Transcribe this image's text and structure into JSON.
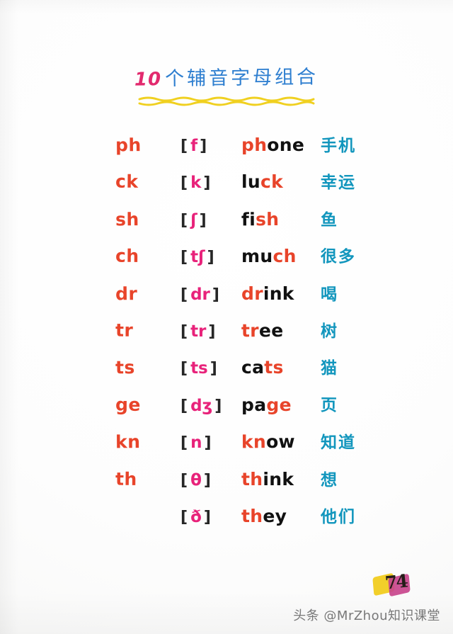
{
  "page": {
    "title": "10个辅音字母组合",
    "title_number": "10",
    "title_text": "个辅音字母组合",
    "colors": {
      "combo_orange": "#e8442a",
      "phonetic_pink": "#e8227a",
      "chinese_teal": "#1296bd",
      "title_blue": "#2f7fd0",
      "title_red": "#e22a6e",
      "underline_yellow": "#f0d020",
      "word_black": "#111111",
      "paper_white": "#fefefe"
    }
  },
  "rows": [
    {
      "combo": "ph",
      "bracket_open": "[",
      "phonetic": "f",
      "bracket_close": "]",
      "word_head": "ph",
      "word_tail": "one",
      "word_head_highlighted": true,
      "word": "phone",
      "chinese": "手机"
    },
    {
      "combo": "ck",
      "bracket_open": "[",
      "phonetic": "k",
      "bracket_close": "]",
      "word_head": "lu",
      "word_tail": "ck",
      "word_head_highlighted": false,
      "word": "luck",
      "chinese": "幸运"
    },
    {
      "combo": "sh",
      "bracket_open": "[",
      "phonetic": "ʃ",
      "bracket_close": "]",
      "word_head": "fi",
      "word_tail": "sh",
      "word_head_highlighted": false,
      "word": "fish",
      "chinese": "鱼"
    },
    {
      "combo": "ch",
      "bracket_open": "[",
      "phonetic": "tʃ",
      "bracket_close": "]",
      "word_head": "mu",
      "word_tail": "ch",
      "word_head_highlighted": false,
      "word": "much",
      "chinese": "很多"
    },
    {
      "combo": "dr",
      "bracket_open": "[",
      "phonetic": "dr",
      "bracket_close": "]",
      "word_head": "dr",
      "word_tail": "ink",
      "word_head_highlighted": true,
      "word": "drink",
      "chinese": "喝"
    },
    {
      "combo": "tr",
      "bracket_open": "[",
      "phonetic": "tr",
      "bracket_close": "]",
      "word_head": "tr",
      "word_tail": "ee",
      "word_head_highlighted": true,
      "word": "tree",
      "chinese": "树"
    },
    {
      "combo": "ts",
      "bracket_open": "[",
      "phonetic": "ts",
      "bracket_close": "]",
      "word_head": "ca",
      "word_tail": "ts",
      "word_head_highlighted": false,
      "word": "cats",
      "chinese": "猫"
    },
    {
      "combo": "ge",
      "bracket_open": "[",
      "phonetic": "dʒ",
      "bracket_close": "]",
      "word_head": "pa",
      "word_tail": "ge",
      "word_head_highlighted": false,
      "word": "page",
      "chinese": "页"
    },
    {
      "combo": "kn",
      "bracket_open": "[",
      "phonetic": "n",
      "bracket_close": "]",
      "word_head": "kn",
      "word_tail": "ow",
      "word_head_highlighted": true,
      "word": "know",
      "chinese": "知道"
    },
    {
      "combo": "th",
      "bracket_open": "[",
      "phonetic": "θ",
      "bracket_close": "]",
      "word_head": "th",
      "word_tail": "ink",
      "word_head_highlighted": true,
      "word": "think",
      "chinese": "想"
    },
    {
      "combo": "",
      "bracket_open": "[",
      "phonetic": "ð",
      "bracket_close": "]",
      "word_head": "th",
      "word_tail": "ey",
      "word_head_highlighted": true,
      "word": "they",
      "chinese": "他们"
    }
  ],
  "watermark": {
    "logo_mark": "74",
    "footer_text": "头条 @MrZhou知识课堂"
  }
}
